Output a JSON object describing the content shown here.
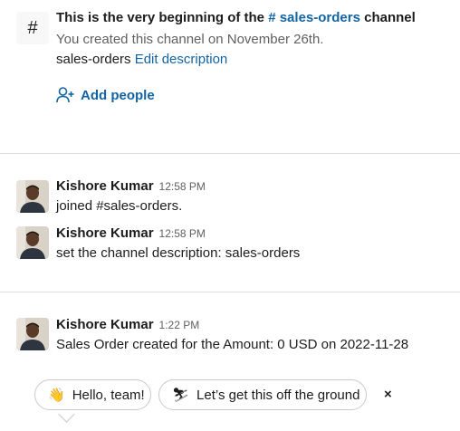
{
  "intro": {
    "hash_glyph": "#",
    "title_prefix": "This is the very beginning of the",
    "channel_link": "# sales-orders",
    "title_suffix": "channel",
    "created_text": "You created this channel on November 26th.",
    "description": "sales-orders",
    "edit_description": "Edit description",
    "add_people": "Add people"
  },
  "messages": [
    {
      "author": "Kishore Kumar",
      "time": "12:58 PM",
      "text": "joined #sales-orders."
    },
    {
      "author": "Kishore Kumar",
      "time": "12:58 PM",
      "text": "set the channel description: sales-orders"
    },
    {
      "author": "Kishore Kumar",
      "time": "1:22 PM",
      "text": "Sales Order created for the Amount: 0 USD on 2022-11-28"
    }
  ],
  "suggestions": {
    "chips": [
      {
        "emoji": "👋",
        "label": "Hello, team!"
      },
      {
        "emoji": "⛷",
        "label": "Let’s get this off the ground"
      }
    ],
    "close": "×"
  },
  "colors": {
    "link": "#1264a3",
    "muted": "#616061",
    "divider": "#dddddd"
  }
}
